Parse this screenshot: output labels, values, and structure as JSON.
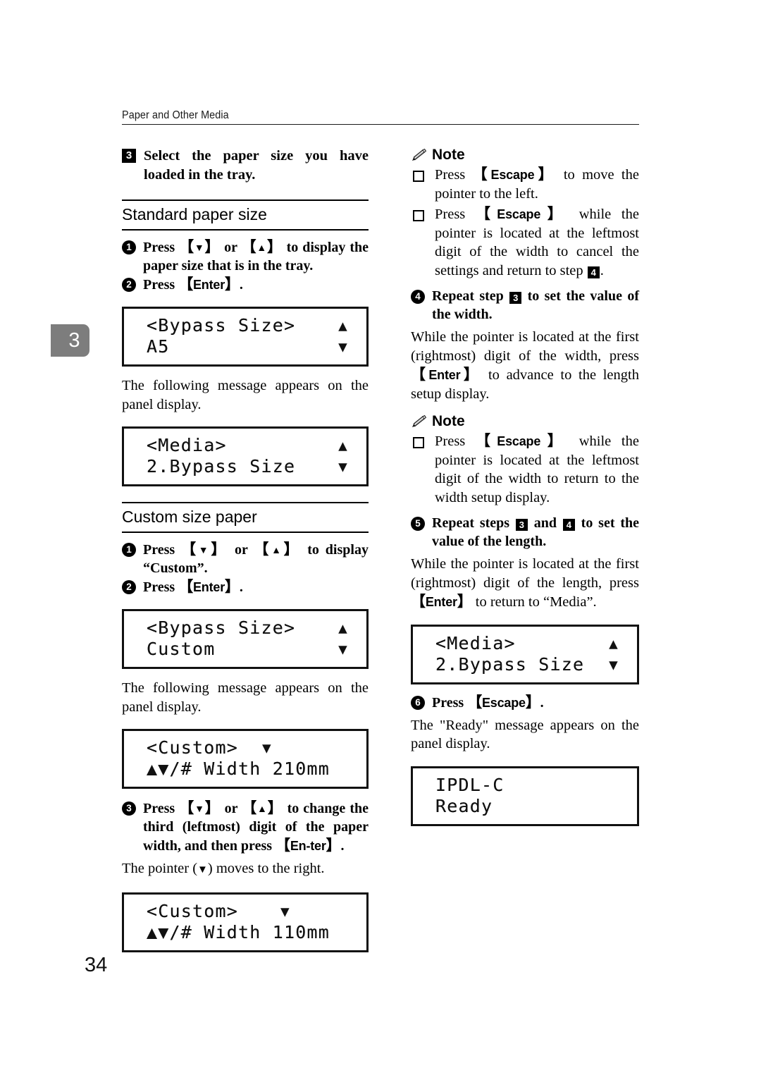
{
  "header": {
    "title": "Paper and Other Media"
  },
  "chapter_tab": {
    "number": "3"
  },
  "folio": {
    "page_number": "34"
  },
  "keys": {
    "enter": "Enter",
    "escape": "Escape",
    "enter_hyphen_1": "En-",
    "enter_hyphen_2": "ter",
    "down": "▼",
    "up": "▲",
    "bracket_open": "【",
    "bracket_close": "】"
  },
  "left_column": {
    "step3": {
      "marker": "3",
      "text": "Select the paper size you have loaded in the tray."
    },
    "standard_section": {
      "heading": "Standard paper size",
      "substep1": {
        "marker": "1",
        "t1": "Press ",
        "t2": " or ",
        "t3": " to display the paper size that is in the tray."
      },
      "substep2": {
        "marker": "2",
        "t1": "Press ",
        "t2": "."
      },
      "lcd_bypass_a5": {
        "line1": "<Bypass Size>",
        "line2": "A5",
        "arrow1": "up-arrow",
        "arrow2": "down-arrow"
      },
      "caption": "The following message appears on the panel display.",
      "lcd_media": {
        "line1": "<Media>",
        "line2": "2.Bypass Size",
        "arrow1": "up-arrow",
        "arrow2": "down-arrow"
      }
    },
    "custom_section": {
      "heading": "Custom size paper",
      "substep1": {
        "marker": "1",
        "t1": "Press ",
        "t2": " or ",
        "t3": " to display “Custom”."
      },
      "substep2": {
        "marker": "2",
        "t1": "Press ",
        "t2": "."
      },
      "lcd_bypass_custom": {
        "line1": "<Bypass Size>",
        "line2": "Custom",
        "arrow1": "up-arrow",
        "arrow2": "down-arrow"
      },
      "caption": "The following message appears on the panel display.",
      "lcd_custom_210": {
        "line1": "<Custom>",
        "line2": "▲▼/# Width 210mm",
        "arrow1": "down-arrow"
      },
      "substep3": {
        "marker": "3",
        "t1": "Press ",
        "t2": " or ",
        "t3": " to change the third (leftmost) digit of the paper width, and then press ",
        "t4": "."
      },
      "pointer_note_a": "The pointer (",
      "pointer_note_b": ") moves to the right.",
      "lcd_custom_110": {
        "line1": "<Custom>",
        "line2": "▲▼/# Width 110mm",
        "arrow1": "down-arrow"
      }
    }
  },
  "right_column": {
    "note1": {
      "label": "Note",
      "items": [
        {
          "t1": "Press ",
          "t2": " to move the pointer to the left."
        },
        {
          "t1": "Press ",
          "t2": " while the pointer is located at the leftmost digit of the width to cancel the settings and return to step ",
          "ref": "4",
          "t3": "."
        }
      ]
    },
    "step4": {
      "marker": "4",
      "t1": "Repeat step ",
      "ref": "3",
      "t2": " to set the value of the width.",
      "body_a": "While the pointer is located at the first (rightmost) digit of the width, press ",
      "body_b": " to advance to the length setup display."
    },
    "note2": {
      "label": "Note",
      "items": [
        {
          "t1": "Press ",
          "t2": " while the pointer is located at the leftmost digit of the width to return to the width setup display."
        }
      ]
    },
    "step5": {
      "marker": "5",
      "t1": "Repeat steps ",
      "ref1": "3",
      "t2": " and ",
      "ref2": "4",
      "t3": " to set the value of the length.",
      "body_a": "While the pointer is located at the first (rightmost) digit of the length, press ",
      "body_b": " to return to “Media”."
    },
    "lcd_media": {
      "line1": "<Media>",
      "line2": "2.Bypass Size",
      "arrow1": "up-arrow",
      "arrow2": "down-arrow"
    },
    "step6": {
      "marker": "6",
      "t1": "Press ",
      "t2": "."
    },
    "ready_caption": "The \"Ready\" message appears on the panel display.",
    "lcd_ready": {
      "line1": "IPDL-C",
      "line2": "Ready"
    }
  }
}
